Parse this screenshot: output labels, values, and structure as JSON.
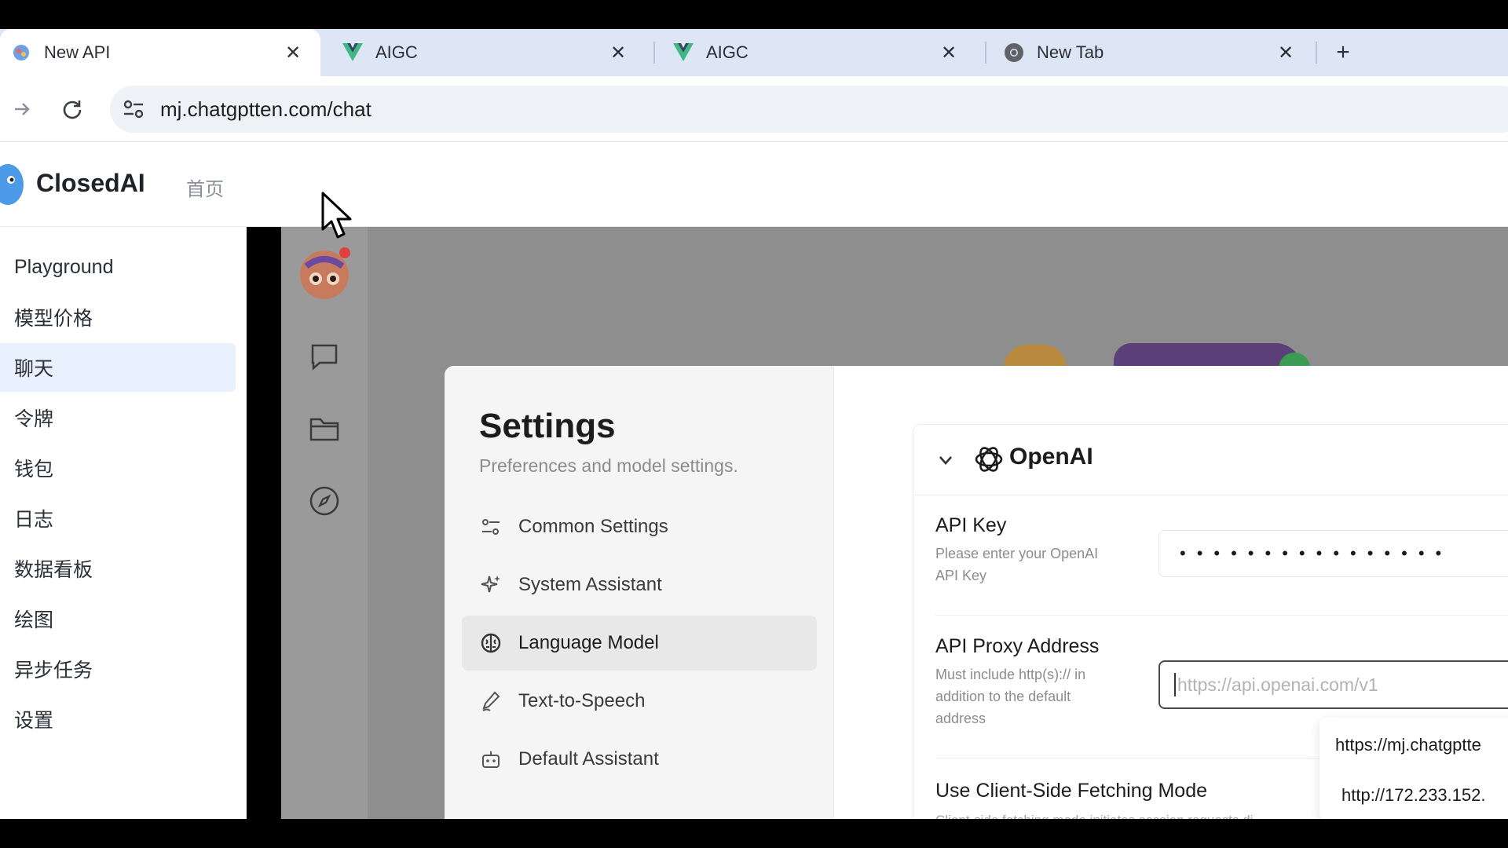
{
  "browser": {
    "tabs": [
      {
        "title": "New API",
        "icon": "new-api-favicon",
        "active": true
      },
      {
        "title": "AIGC",
        "icon": "vue-favicon",
        "active": false
      },
      {
        "title": "AIGC",
        "icon": "vue-favicon",
        "active": false
      },
      {
        "title": "New Tab",
        "icon": "chrome-favicon",
        "active": false
      }
    ],
    "close_glyph": "✕",
    "newtab_glyph": "+",
    "url": "mj.chatgptten.com/chat"
  },
  "header": {
    "brand": "ClosedAI",
    "home_link": "首页"
  },
  "sidebar": {
    "items": [
      {
        "label": "Playground"
      },
      {
        "label": "模型价格"
      },
      {
        "label": "聊天",
        "selected": true
      },
      {
        "label": "令牌"
      },
      {
        "label": "钱包"
      },
      {
        "label": "日志"
      },
      {
        "label": "数据看板"
      },
      {
        "label": "绘图"
      },
      {
        "label": "异步任务"
      },
      {
        "label": "设置"
      }
    ]
  },
  "settings": {
    "title": "Settings",
    "subtitle": "Preferences and model settings.",
    "menu": [
      {
        "label": "Common Settings",
        "icon": "sliders-icon"
      },
      {
        "label": "System Assistant",
        "icon": "sparkles-icon"
      },
      {
        "label": "Language Model",
        "icon": "brain-icon",
        "selected": true
      },
      {
        "label": "Text-to-Speech",
        "icon": "pen-icon"
      },
      {
        "label": "Default Assistant",
        "icon": "bot-icon"
      }
    ],
    "provider": {
      "name": "OpenAI",
      "api_key_label": "API Key",
      "api_key_desc": "Please enter your OpenAI API Key",
      "api_key_value": "••••••••••••••••",
      "proxy_label": "API Proxy Address",
      "proxy_desc": "Must include http(s):// in addition to the default address",
      "proxy_placeholder": "https://api.openai.com/v1",
      "suggestions": [
        "https://mj.chatgptte",
        "http://172.233.152."
      ],
      "fetch_label": "Use Client-Side Fetching Mode",
      "fetch_desc": "Client-side fetching mode initiates session requests di"
    }
  },
  "colors": {
    "tabstrip": "#dce6f5",
    "sidebar_selected": "#e9f1fe",
    "overlay": "#8e8e8e"
  }
}
